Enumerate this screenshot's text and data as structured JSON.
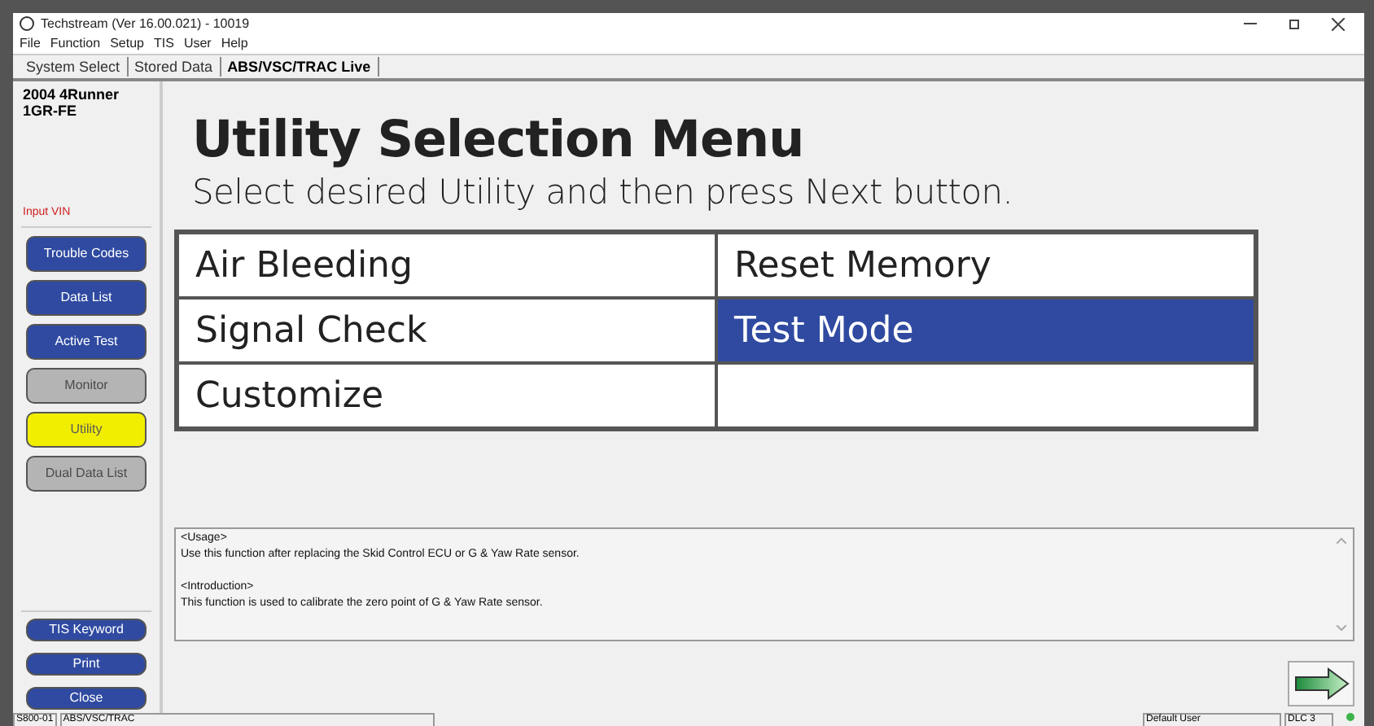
{
  "window": {
    "title": "Techstream (Ver 16.00.021) - 10019"
  },
  "menu": [
    "File",
    "Function",
    "Setup",
    "TIS",
    "User",
    "Help"
  ],
  "tabs": [
    {
      "label": "System Select",
      "selected": false
    },
    {
      "label": "Stored Data",
      "selected": false
    },
    {
      "label": "ABS/VSC/TRAC Live",
      "selected": true
    }
  ],
  "vehicle": {
    "model": "2004 4Runner",
    "engine": "1GR-FE",
    "input_vin": "Input VIN"
  },
  "sidebar": {
    "items": [
      {
        "label": "Trouble Codes",
        "selected": false,
        "disabled": false
      },
      {
        "label": "Data List",
        "selected": false,
        "disabled": false
      },
      {
        "label": "Active Test",
        "selected": false,
        "disabled": false
      },
      {
        "label": "Monitor",
        "selected": false,
        "disabled": true
      },
      {
        "label": "Utility",
        "selected": true,
        "disabled": false
      },
      {
        "label": "Dual Data List",
        "selected": false,
        "disabled": true
      }
    ],
    "bottom_items": [
      "TIS Keyword",
      "Print",
      "Close"
    ]
  },
  "main": {
    "title": "Utility Selection Menu",
    "subtitle": "Select desired Utility and then press Next button.",
    "options": [
      {
        "label": "Air Bleeding",
        "selected": false
      },
      {
        "label": "Reset Memory",
        "selected": false
      },
      {
        "label": "Signal Check",
        "selected": false
      },
      {
        "label": "Test Mode",
        "selected": true
      },
      {
        "label": "Customize",
        "selected": false
      }
    ],
    "info": [
      "<Usage>",
      "Use this function after replacing the Skid Control ECU or G & Yaw Rate sensor.",
      "<Introduction>",
      "This function is used to calibrate the zero point of G & Yaw Rate sensor."
    ]
  },
  "status_bar": [
    "S800-01",
    "ABS/VSC/TRAC",
    "Default User",
    "DLC 3"
  ]
}
